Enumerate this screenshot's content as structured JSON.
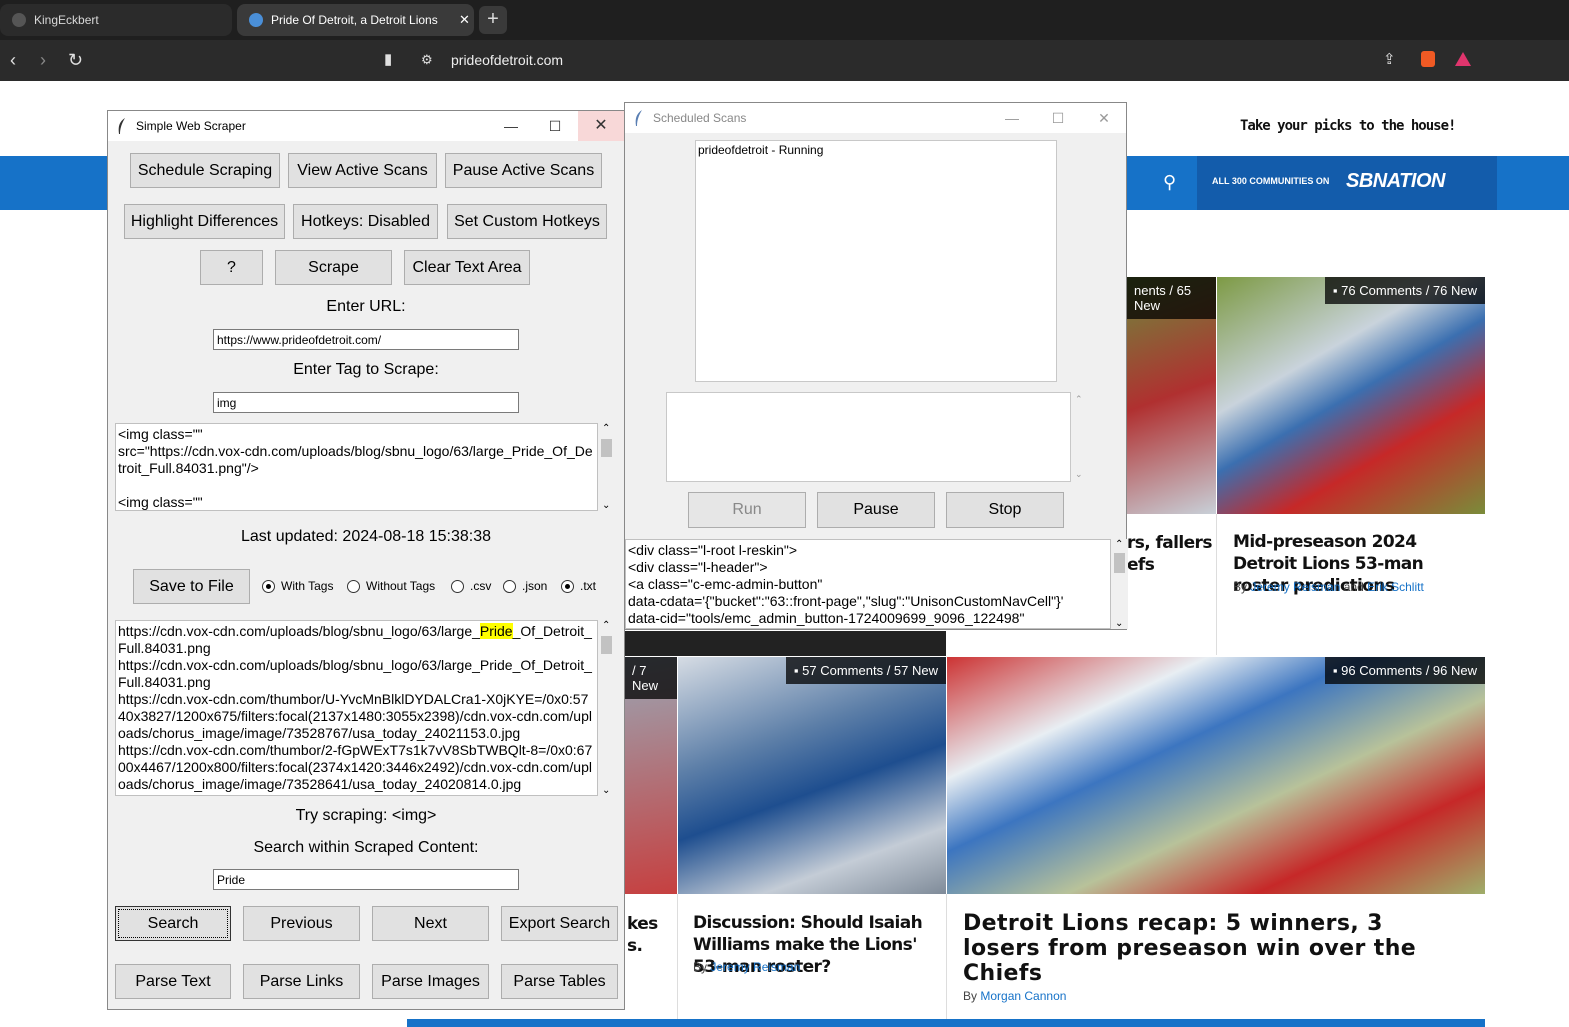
{
  "browser": {
    "tabs": [
      {
        "label": "KingEckbert"
      },
      {
        "label": "Pride Of Detroit, a Detroit Lions"
      }
    ],
    "new_tab": "+",
    "url": "prideofdetroit.com"
  },
  "site": {
    "promo": "Take your picks to the house!",
    "sbnation_communities": "ALL 300 COMMUNITIES ON",
    "sbnation_logo": "SBNATION",
    "cards": [
      {
        "badge": "nents / 65 New",
        "headline": "rs, fallers\nefs"
      },
      {
        "badge": "76 Comments / 76 New",
        "headline": "Mid-preseason 2024 Detroit Lions 53-man roster predictions",
        "byline_prefix": "By",
        "author1": "Jeremy Reisman",
        "and": "and",
        "author2": "Erik Schlitt"
      },
      {
        "badge": "/ 7 New",
        "headline": "kes\ns."
      },
      {
        "badge": "57 Comments / 57 New",
        "headline": "Discussion: Should Isaiah Williams make the Lions' 53-man roster?",
        "byline_prefix": "By",
        "author1": "Jeremy Reisman"
      },
      {
        "badge": "96 Comments / 96 New",
        "headline": "Detroit Lions recap: 5 winners, 3 losers from preseason win over the Chiefs",
        "byline_prefix": "By",
        "author1": "Morgan Cannon"
      }
    ]
  },
  "scraper": {
    "title": "Simple Web Scraper",
    "buttons": {
      "schedule": "Schedule Scraping",
      "view_active": "View Active Scans",
      "pause_active": "Pause Active Scans",
      "highlight": "Highlight Differences",
      "hotkeys": "Hotkeys: Disabled",
      "custom_hotkeys": "Set Custom Hotkeys",
      "help": "?",
      "scrape": "Scrape",
      "clear": "Clear Text Area",
      "save": "Save to File",
      "search": "Search",
      "previous": "Previous",
      "next": "Next",
      "export": "Export Search",
      "parse_text": "Parse Text",
      "parse_links": "Parse Links",
      "parse_images": "Parse Images",
      "parse_tables": "Parse Tables"
    },
    "url_label": "Enter URL:",
    "url_value": "https://www.prideofdetroit.com/",
    "tag_label": "Enter Tag to Scrape:",
    "tag_value": "img",
    "output_text": "<img class=\"\"\nsrc=\"https://cdn.vox-cdn.com/uploads/blog/sbnu_logo/63/large_Pride_Of_Detroit_Full.84031.png\"/>\n\n<img class=\"\"",
    "last_updated": "Last updated: 2024-08-18 15:38:38",
    "radios": [
      {
        "label": "With Tags",
        "checked": true
      },
      {
        "label": "Without Tags",
        "checked": false
      },
      {
        "label": ".csv",
        "checked": false
      },
      {
        "label": ".json",
        "checked": false
      },
      {
        "label": ".txt",
        "checked": true
      }
    ],
    "results": {
      "line1_before": "https://cdn.vox-cdn.com/uploads/blog/sbnu_logo/63/large_",
      "line1_match": "Pride",
      "line1_after": "_Of_Detroit_Full.84031.png",
      "rest": "https://cdn.vox-cdn.com/uploads/blog/sbnu_logo/63/large_Pride_Of_Detroit_Full.84031.png\nhttps://cdn.vox-cdn.com/thumbor/U-YvcMnBlklDYDALCra1-X0jKYE=/0x0:5740x3827/1200x675/filters:focal(2137x1480:3055x2398)/cdn.vox-cdn.com/uploads/chorus_image/image/73528767/usa_today_24021153.0.jpg\nhttps://cdn.vox-cdn.com/thumbor/2-fGpWExT7s1k7vV8SbTWBQlt-8=/0x0:6700x4467/1200x800/filters:focal(2374x1420:3446x2492)/cdn.vox-cdn.com/uploads/chorus_image/image/73528641/usa_today_24020814.0.jpg"
    },
    "try_scraping": "Try scraping: <img>",
    "search_label": "Search within Scraped Content:",
    "search_value": "Pride"
  },
  "scheduled": {
    "title": "Scheduled Scans",
    "list_items": [
      "prideofdetroit - Running"
    ],
    "run": "Run",
    "pause": "Pause",
    "stop": "Stop",
    "html_text": "<div class=\"l-root l-reskin\">\n<div class=\"l-header\">\n<a class=\"c-emc-admin-button\"\ndata-cdata='{\"bucket\":\"63::front-page\",\"slug\":\"UnisonCustomNavCell\"}'\ndata-cid=\"tools/emc_admin_button-1724009699_9096_122498\""
  },
  "colors": {
    "accent": "#1672c8",
    "highlight": "#ffff00"
  }
}
